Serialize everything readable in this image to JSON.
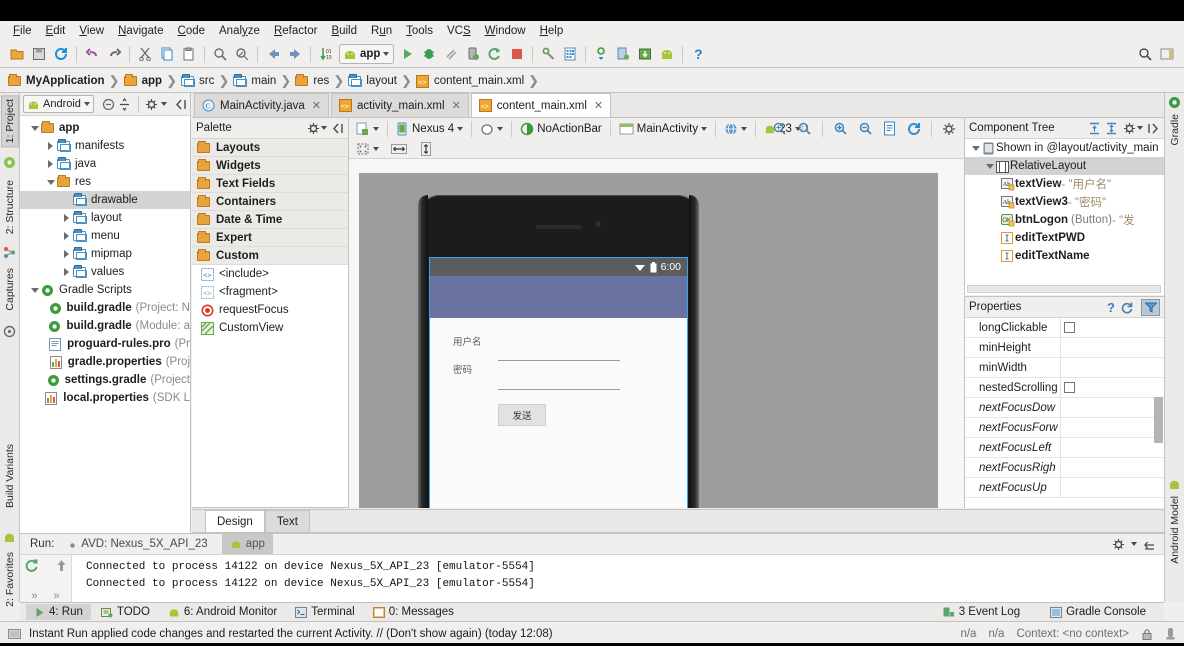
{
  "menu": {
    "items": [
      "File",
      "Edit",
      "View",
      "Navigate",
      "Code",
      "Analyze",
      "Refactor",
      "Build",
      "Run",
      "Tools",
      "VCS",
      "Window",
      "Help"
    ]
  },
  "toolbar": {
    "run_config_label": "app",
    "icons": [
      "open-folder-icon",
      "save-all-icon",
      "sync-icon",
      "undo-icon",
      "redo-icon",
      "cut-icon",
      "copy-icon",
      "paste-icon",
      "find-icon",
      "find-replace-icon",
      "back-icon",
      "forward-icon",
      "sort-icon",
      "run-icon",
      "debug-icon",
      "coverage-icon",
      "profile-icon",
      "rerun-icon",
      "stop-icon",
      "sdk-manager-icon",
      "avd-manager-icon",
      "sync-gradle-icon",
      "device-monitor-icon",
      "download-sdk-icon",
      "android-icon",
      "help-icon",
      "search-icon",
      "settings-icon"
    ],
    "search_icon": "search-icon"
  },
  "breadcrumb": {
    "items": [
      {
        "label": "MyApplication",
        "icon": "module-folder-icon",
        "bold": true
      },
      {
        "label": "app",
        "icon": "module-folder-icon",
        "bold": true
      },
      {
        "label": "src",
        "icon": "folder-icon",
        "bold": false
      },
      {
        "label": "main",
        "icon": "folder-icon",
        "bold": false
      },
      {
        "label": "res",
        "icon": "res-folder-icon",
        "bold": false
      },
      {
        "label": "layout",
        "icon": "layout-folder-icon",
        "bold": false
      },
      {
        "label": "content_main.xml",
        "icon": "xml-file-icon",
        "bold": false
      }
    ]
  },
  "left_strip": {
    "tabs": [
      {
        "label": "1: Project",
        "icon": "project-icon",
        "active": true
      },
      {
        "label": "2: Structure",
        "icon": "structure-icon",
        "active": false
      },
      {
        "label": "Captures",
        "icon": "captures-icon",
        "active": false
      },
      {
        "label": "Build Variants",
        "icon": "android-icon",
        "active": false
      },
      {
        "label": "2: Favorites",
        "icon": "star-icon",
        "active": false
      }
    ]
  },
  "right_strip": {
    "tabs": [
      {
        "label": "Gradle",
        "icon": "gradle-icon"
      },
      {
        "label": "Android Model",
        "icon": "android-icon"
      }
    ]
  },
  "project": {
    "header": {
      "selector_label": "Android",
      "icons": [
        "android-icon",
        "chevron-down-icon",
        "collapse-all-icon",
        "expand-all-icon",
        "gear-icon",
        "hide-icon"
      ]
    },
    "tree": [
      {
        "label": "app",
        "sub": "",
        "indent": 0,
        "arrow": "down",
        "icon": "module-folder-icon",
        "bold": true,
        "selected": false
      },
      {
        "label": "manifests",
        "sub": "",
        "indent": 1,
        "arrow": "right",
        "icon": "folder-blue-icon",
        "bold": false,
        "selected": false
      },
      {
        "label": "java",
        "sub": "",
        "indent": 1,
        "arrow": "right",
        "icon": "folder-blue-icon",
        "bold": false,
        "selected": false
      },
      {
        "label": "res",
        "sub": "",
        "indent": 1,
        "arrow": "down",
        "icon": "res-folder-icon",
        "bold": false,
        "selected": false
      },
      {
        "label": "drawable",
        "sub": "",
        "indent": 2,
        "arrow": "none",
        "icon": "res-type-folder-icon",
        "bold": false,
        "selected": true
      },
      {
        "label": "layout",
        "sub": "",
        "indent": 2,
        "arrow": "right",
        "icon": "res-type-folder-icon",
        "bold": false,
        "selected": false
      },
      {
        "label": "menu",
        "sub": "",
        "indent": 2,
        "arrow": "right",
        "icon": "res-type-folder-icon",
        "bold": false,
        "selected": false
      },
      {
        "label": "mipmap",
        "sub": "",
        "indent": 2,
        "arrow": "right",
        "icon": "res-type-folder-icon",
        "bold": false,
        "selected": false
      },
      {
        "label": "values",
        "sub": "",
        "indent": 2,
        "arrow": "right",
        "icon": "res-type-folder-icon",
        "bold": false,
        "selected": false
      },
      {
        "label": "Gradle Scripts",
        "sub": "",
        "indent": 0,
        "arrow": "down",
        "icon": "gradle-icon",
        "bold": false,
        "selected": false
      },
      {
        "label": "build.gradle",
        "sub": "(Project: N",
        "indent": 1,
        "arrow": "none",
        "icon": "gradle-icon",
        "bold": false,
        "selected": false
      },
      {
        "label": "build.gradle",
        "sub": "(Module: a",
        "indent": 1,
        "arrow": "none",
        "icon": "gradle-icon",
        "bold": false,
        "selected": false
      },
      {
        "label": "proguard-rules.pro",
        "sub": "(Pr",
        "indent": 1,
        "arrow": "none",
        "icon": "file-icon",
        "bold": false,
        "selected": false
      },
      {
        "label": "gradle.properties",
        "sub": "(Proj",
        "indent": 1,
        "arrow": "none",
        "icon": "properties-icon",
        "bold": false,
        "selected": false
      },
      {
        "label": "settings.gradle",
        "sub": "(Project",
        "indent": 1,
        "arrow": "none",
        "icon": "gradle-icon",
        "bold": false,
        "selected": false
      },
      {
        "label": "local.properties",
        "sub": "(SDK L",
        "indent": 1,
        "arrow": "none",
        "icon": "properties-icon",
        "bold": false,
        "selected": false
      }
    ]
  },
  "palette": {
    "title": "Palette",
    "header_icons": [
      "gear-icon",
      "hide-icon"
    ],
    "groups": [
      "Layouts",
      "Widgets",
      "Text Fields",
      "Containers",
      "Date & Time",
      "Expert",
      "Custom"
    ],
    "items": [
      {
        "label": "<include>",
        "icon": "include-tag-icon"
      },
      {
        "label": "<fragment>",
        "icon": "fragment-tag-icon"
      },
      {
        "label": "requestFocus",
        "icon": "request-focus-icon"
      },
      {
        "label": "CustomView",
        "icon": "custom-view-icon"
      }
    ]
  },
  "editor_tabs": [
    {
      "label": "MainActivity.java",
      "icon": "java-class-icon",
      "active": false
    },
    {
      "label": "activity_main.xml",
      "icon": "xml-layout-icon",
      "active": false
    },
    {
      "label": "content_main.xml",
      "icon": "xml-layout-icon",
      "active": true
    }
  ],
  "design_toolbar": {
    "device_label": "Nexus 4",
    "theme_label": "NoActionBar",
    "activity_label": "MainActivity",
    "api_label": "23",
    "orientation_icon": "device-orientation-icon",
    "locale_icon": "globe-icon",
    "zoom_icons": [
      "zoom-to-fit-icon",
      "zoom-actual-icon",
      "zoom-in-icon",
      "zoom-out-icon",
      "render-icon",
      "refresh-icon",
      "gear-icon"
    ],
    "row2_icons": [
      "blueprint-toggle-icon",
      "expand-horizontal-icon",
      "expand-vertical-icon"
    ]
  },
  "preview": {
    "device_time": "6:00",
    "wifi_icon": "wifi-icon",
    "battery_icon": "battery-icon",
    "username_label": "用户名",
    "password_label": "密码",
    "send_button": "发送",
    "appbar_color": "#6a72a0",
    "selection_color": "#3aa0f0"
  },
  "design_text_tabs": [
    {
      "label": "Design",
      "active": true
    },
    {
      "label": "Text",
      "active": false
    }
  ],
  "component_tree": {
    "title": "Component Tree",
    "header_icons": [
      "expand-all-icon",
      "collapse-all-icon",
      "gear-icon",
      "hide-icon"
    ],
    "rows": [
      {
        "name": "Shown in @layout/activity_main",
        "extra": "",
        "value": "",
        "indent": 0,
        "arrow": "down",
        "icon": "device-screen-icon",
        "bold": false,
        "selected": false
      },
      {
        "name": "RelativeLayout",
        "extra": "",
        "value": "",
        "indent": 1,
        "arrow": "down",
        "icon": "relative-layout-icon",
        "bold": false,
        "selected": true
      },
      {
        "name": "textView",
        "extra": "",
        "value": "- \"用户名\"",
        "indent": 2,
        "arrow": "none",
        "icon": "textview-icon",
        "bold": true,
        "selected": false
      },
      {
        "name": "textView3",
        "extra": "",
        "value": "- \"密码\"",
        "indent": 2,
        "arrow": "none",
        "icon": "textview-icon",
        "bold": true,
        "selected": false
      },
      {
        "name": "btnLogon",
        "extra": "(Button)",
        "value": "- \"发",
        "indent": 2,
        "arrow": "none",
        "icon": "button-icon",
        "bold": true,
        "selected": false
      },
      {
        "name": "editTextPWD",
        "extra": "",
        "value": "",
        "indent": 2,
        "arrow": "none",
        "icon": "edittext-icon",
        "bold": true,
        "selected": false
      },
      {
        "name": "editTextName",
        "extra": "",
        "value": "",
        "indent": 2,
        "arrow": "none",
        "icon": "edittext-icon",
        "bold": true,
        "selected": false
      }
    ]
  },
  "properties": {
    "title": "Properties",
    "header_icons": [
      "help-icon",
      "restore-icon",
      "filter-icon"
    ],
    "rows": [
      {
        "key": "longClickable",
        "value": "",
        "type": "checkbox",
        "italic": false
      },
      {
        "key": "minHeight",
        "value": "",
        "type": "text",
        "italic": false
      },
      {
        "key": "minWidth",
        "value": "",
        "type": "text",
        "italic": false
      },
      {
        "key": "nestedScrolling",
        "value": "",
        "type": "checkbox",
        "italic": false
      },
      {
        "key": "nextFocusDow",
        "value": "",
        "type": "text",
        "italic": true
      },
      {
        "key": "nextFocusForw",
        "value": "",
        "type": "text",
        "italic": true
      },
      {
        "key": "nextFocusLeft",
        "value": "",
        "type": "text",
        "italic": true
      },
      {
        "key": "nextFocusRigh",
        "value": "",
        "type": "text",
        "italic": true
      },
      {
        "key": "nextFocusUp",
        "value": "",
        "type": "text",
        "italic": true
      }
    ]
  },
  "run_panel": {
    "label": "Run:",
    "avd_tab": "AVD: Nexus_5X_API_23",
    "app_tab": "app",
    "console_lines": [
      "Connected to process 14122 on device Nexus_5X_API_23 [emulator-5554]",
      "Connected to process 14122 on device Nexus_5X_API_23 [emulator-5554]"
    ],
    "left_icons": [
      "rerun-icon",
      "scroll-up-icon",
      "expand-more-icon",
      "expand-more-2-icon"
    ],
    "header_icons": [
      "gear-icon",
      "hide-icon"
    ]
  },
  "bottom_tabs": {
    "tabs": [
      {
        "label": "4: Run",
        "icon": "run-green-icon",
        "active": true
      },
      {
        "label": "TODO",
        "icon": "todo-icon",
        "active": false
      },
      {
        "label": "6: Android Monitor",
        "icon": "android-icon",
        "active": false
      },
      {
        "label": "Terminal",
        "icon": "terminal-icon",
        "active": false
      },
      {
        "label": "0: Messages",
        "icon": "messages-icon",
        "active": false
      }
    ],
    "right": [
      {
        "label": "3 Event Log",
        "icon": "event-log-icon"
      },
      {
        "label": "Gradle Console",
        "icon": "gradle-console-icon"
      }
    ]
  },
  "status_bar": {
    "message": "Instant Run applied code changes and restarted the current Activity. // (Don't show again) (today 12:08)",
    "icon": "instant-run-icon",
    "right_items": [
      "n/a",
      "n/a",
      "Context: <no context>"
    ],
    "lock_icon": "lock-icon",
    "memory_icon": "memory-icon"
  }
}
